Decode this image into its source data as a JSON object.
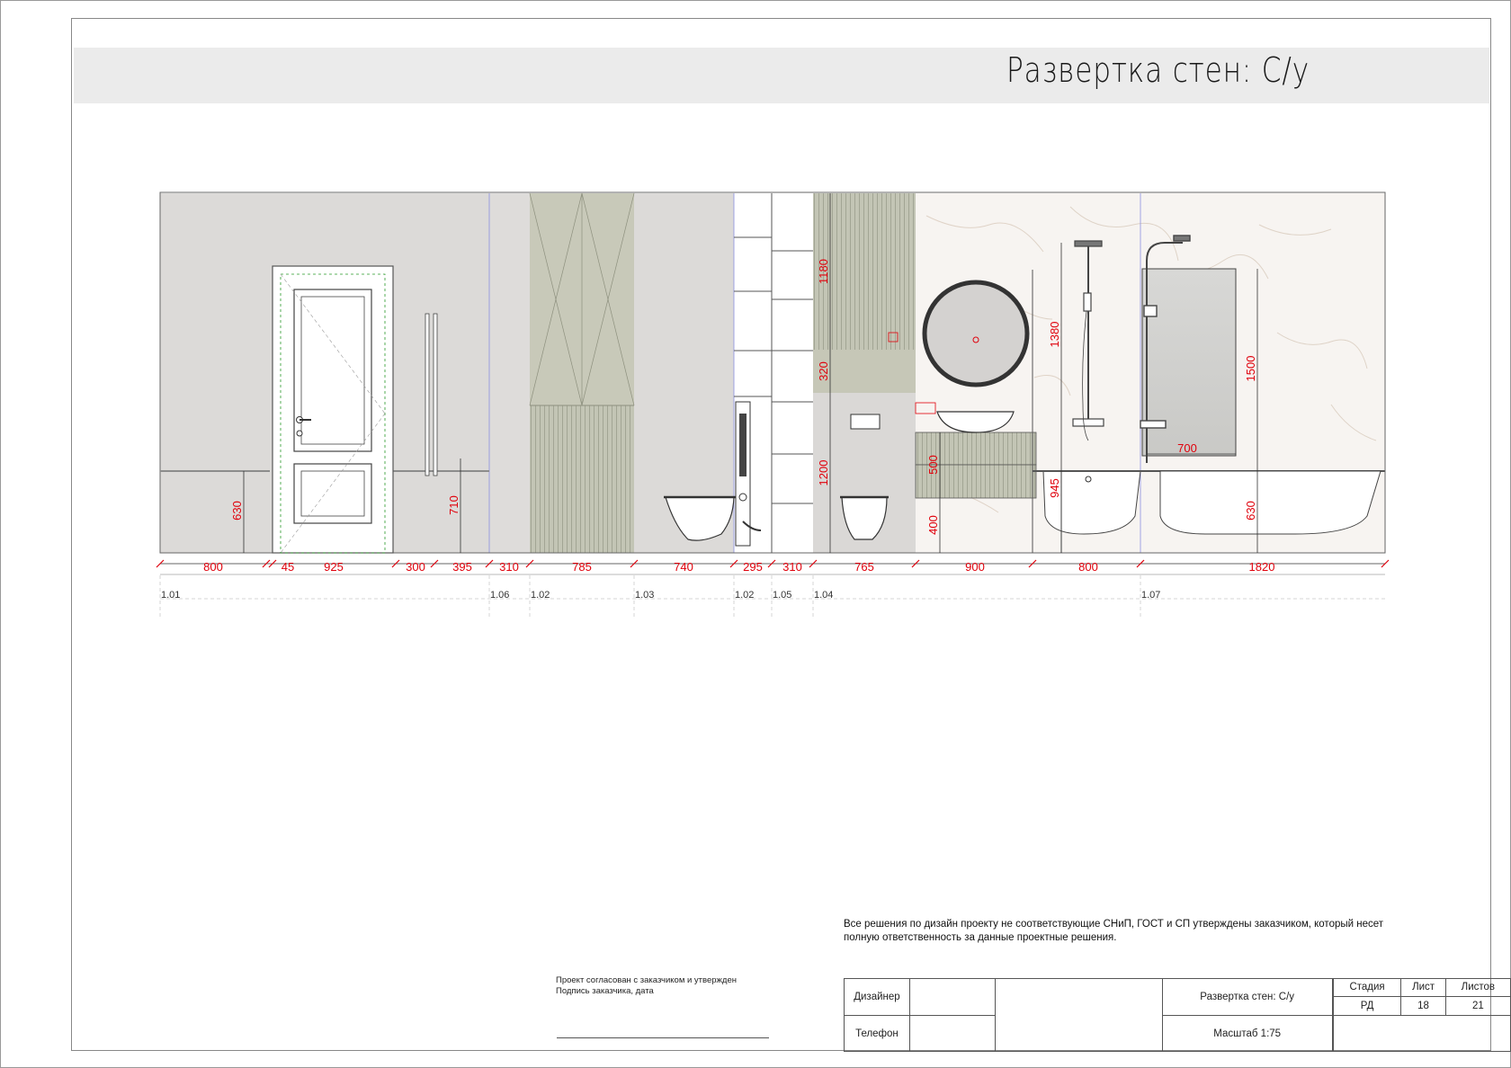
{
  "title": "Развертка стен: С/у",
  "dimensions": {
    "horizontal": [
      "800",
      "45",
      "925",
      "300",
      "395",
      "310",
      "785",
      "740",
      "295",
      "310",
      "765",
      "900",
      "800",
      "1820"
    ],
    "vertical": [
      "630",
      "710",
      "1180",
      "320",
      "1200",
      "1380",
      "500",
      "400",
      "945",
      "1500",
      "630"
    ],
    "shower_width": "700"
  },
  "codes": [
    "1.01",
    "1.06",
    "1.02",
    "1.03",
    "1.02",
    "1.05",
    "1.04",
    "1.07"
  ],
  "note": "Все решения по дизайн проекту не соответствующие СНиП, ГОСТ и СП утверждены заказчиком, который несет полную ответственность за данные проектные решения.",
  "approval": {
    "line1": "Проект согласован с заказчиком и утвержден",
    "line2": "Подпись заказчика, дата"
  },
  "stamp": {
    "designer": "Дизайнер",
    "phone": "Телефон",
    "sheet_title": "Развертка стен: С/у",
    "scale": "Масштаб 1:75",
    "stage_label": "Стадия",
    "sheet_label": "Лист",
    "sheets_label": "Листов",
    "stage": "РД",
    "sheet": "18",
    "sheets": "21"
  },
  "colors": {
    "concrete": "#dad8d6",
    "sage": "#c6c7b7",
    "marble": "#f7f4f1",
    "dimension": "#e0000b"
  }
}
